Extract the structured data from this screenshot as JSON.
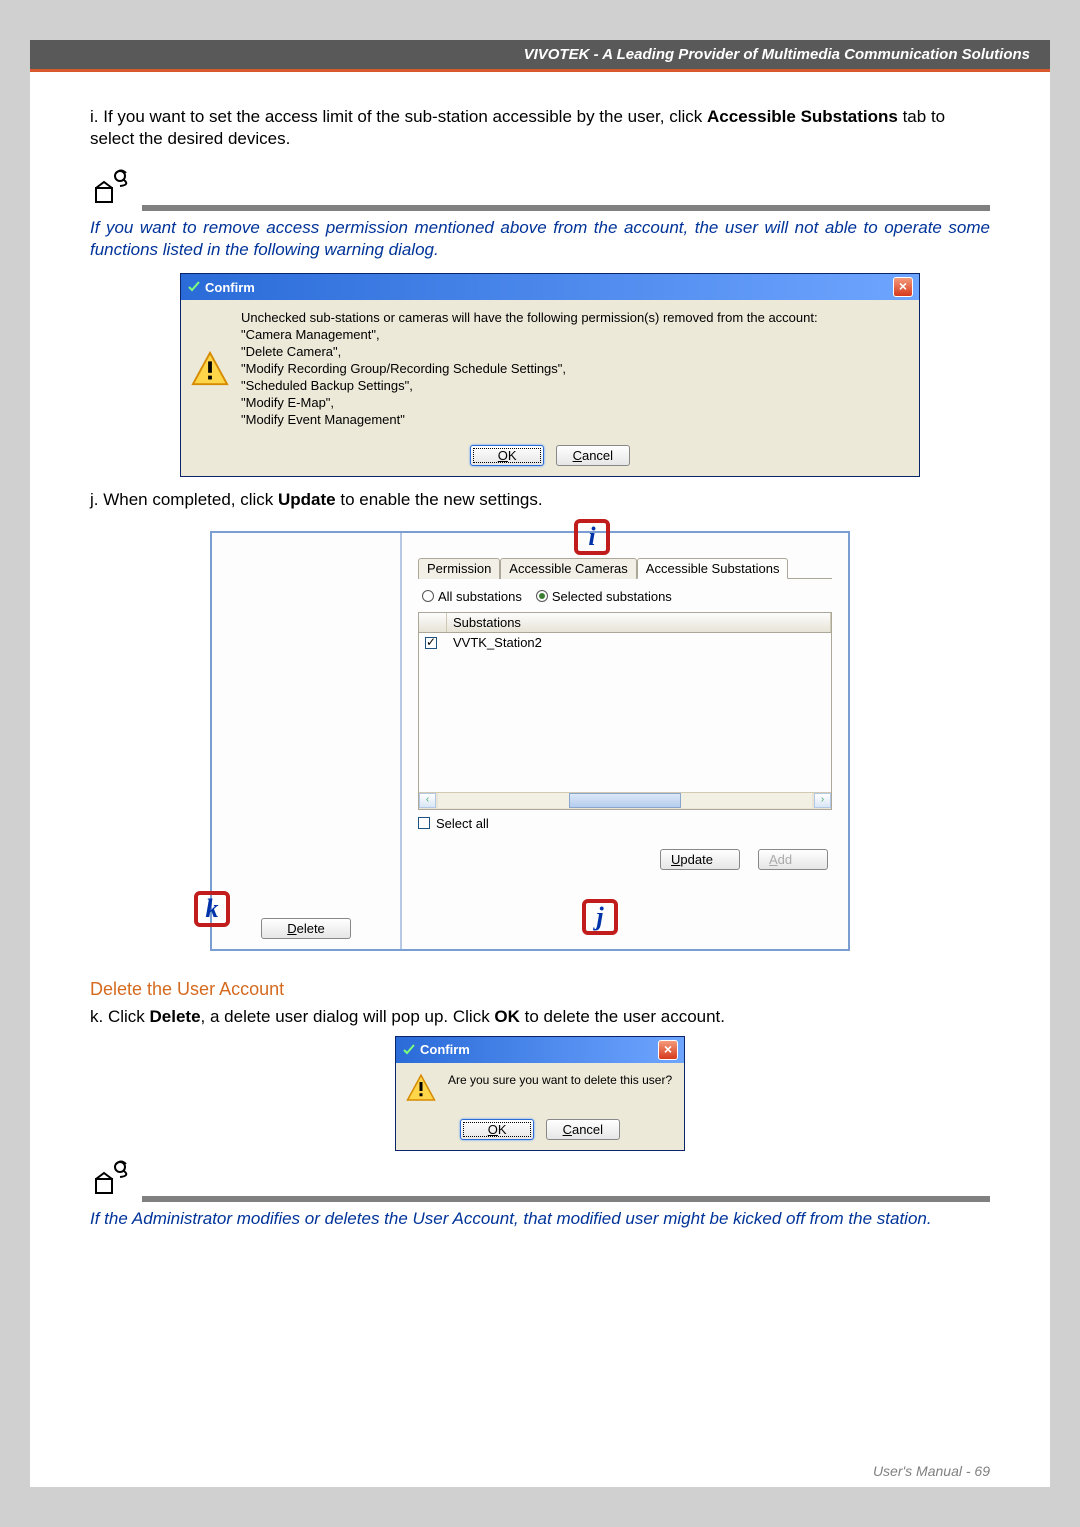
{
  "header": {
    "title": "VIVOTEK - A Leading Provider of Multimedia Communication Solutions"
  },
  "step_i": {
    "prefix": "i. If you want to set the access limit of the sub-station accessible by the user, click ",
    "bold1": "Accessible Substations",
    "suffix": " tab to select the desired devices."
  },
  "note1": "If you want to remove access permission mentioned above from the account, the user will not able to operate some functions listed in the following warning dialog.",
  "confirm1": {
    "title": "Confirm",
    "lines": [
      "Unchecked sub-stations or cameras will have the following permission(s) removed from the account:",
      "\"Camera Management\",",
      "\"Delete Camera\",",
      "\"Modify Recording Group/Recording Schedule Settings\",",
      "\"Scheduled Backup Settings\",",
      "\"Modify E-Map\",",
      "\"Modify Event Management\""
    ],
    "ok": "OK",
    "cancel": "Cancel"
  },
  "step_j": {
    "prefix": "j. When completed, click ",
    "bold": "Update",
    "suffix": " to enable the new settings."
  },
  "panel": {
    "tabs": [
      "Permission",
      "Accessible Cameras",
      "Accessible Substations"
    ],
    "radio_all": "All substations",
    "radio_selected": "Selected substations",
    "col_header": "Substations",
    "row0": "VVTK_Station2",
    "select_all": "Select all",
    "delete": "Delete",
    "update": "Update",
    "add": "Add"
  },
  "markers": {
    "i": "i",
    "j": "j",
    "k": "k"
  },
  "section_delete": "Delete the User Account",
  "step_k": {
    "prefix": "k. Click ",
    "bold1": "Delete",
    "mid": ", a delete user dialog will pop up. Click ",
    "bold2": "OK",
    "suffix": " to delete the user account."
  },
  "confirm2": {
    "title": "Confirm",
    "msg": "Are you sure you want to delete this user?",
    "ok": "OK",
    "cancel": "Cancel"
  },
  "note2": "If the Administrator modifies or deletes the User Account, that modified user might be kicked off from the station.",
  "footer": "User's Manual - 69"
}
